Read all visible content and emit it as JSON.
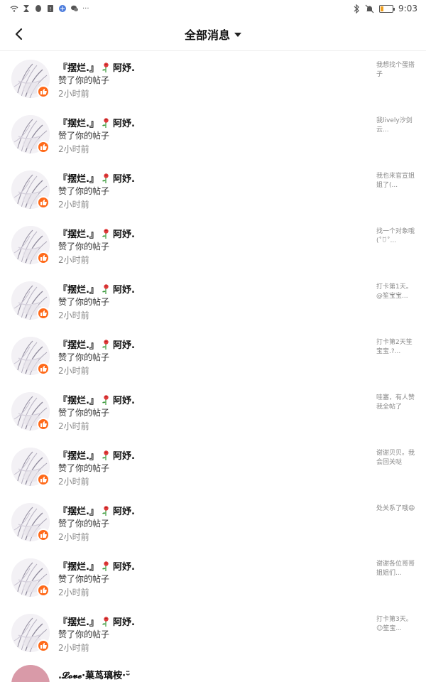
{
  "status_bar": {
    "time": "9:03",
    "left_icons": [
      "wifi-icon",
      "hourglass-icon",
      "qq-icon",
      "sim-icon",
      "browser-icon",
      "wechat-icon",
      "more-dots-icon"
    ],
    "more_label": "···",
    "right_icons": [
      "bluetooth-icon",
      "mute-icon",
      "battery-icon"
    ],
    "battery_level": 0.2
  },
  "header": {
    "title": "全部消息"
  },
  "notifications": [
    {
      "name_left": "『摆烂.』",
      "name_right": "阿妤.",
      "action": "赞了你的帖子",
      "time": "2小时前",
      "snippet": "我想找个蛋搭子"
    },
    {
      "name_left": "『摆烂.』",
      "name_right": "阿妤.",
      "action": "赞了你的帖子",
      "time": "2小时前",
      "snippet": "我lively汐剑云..."
    },
    {
      "name_left": "『摆烂.』",
      "name_right": "阿妤.",
      "action": "赞了你的帖子",
      "time": "2小时前",
      "snippet": "我也来官宣姐姐了(..."
    },
    {
      "name_left": "『摆烂.』",
      "name_right": "阿妤.",
      "action": "赞了你的帖子",
      "time": "2小时前",
      "snippet": "找一个对象哦(˚ꇴ˚..."
    },
    {
      "name_left": "『摆烂.』",
      "name_right": "阿妤.",
      "action": "赞了你的帖子",
      "time": "2小时前",
      "snippet": "打卡第1天。@笙宝宝..."
    },
    {
      "name_left": "『摆烂.』",
      "name_right": "阿妤.",
      "action": "赞了你的帖子",
      "time": "2小时前",
      "snippet": "打卡第2天笙宝宝.?..."
    },
    {
      "name_left": "『摆烂.』",
      "name_right": "阿妤.",
      "action": "赞了你的帖子",
      "time": "2小时前",
      "snippet": "哇塞，有人赞我全帖了"
    },
    {
      "name_left": "『摆烂.』",
      "name_right": "阿妤.",
      "action": "赞了你的帖子",
      "time": "2小时前",
      "snippet": "谢谢贝贝。我会回关哒"
    },
    {
      "name_left": "『摆烂.』",
      "name_right": "阿妤.",
      "action": "赞了你的帖子",
      "time": "2小时前",
      "snippet": "处关系了哦😄"
    },
    {
      "name_left": "『摆烂.』",
      "name_right": "阿妤.",
      "action": "赞了你的帖子",
      "time": "2小时前",
      "snippet": "谢谢各位哥哥姐姐们..."
    },
    {
      "name_left": "『摆烂.』",
      "name_right": "阿妤.",
      "action": "赞了你的帖子",
      "time": "2小时前",
      "snippet": "打卡第3天。😉笙宝..."
    }
  ],
  "partial_item": {
    "name": ".𝓛𝓸𝓿𝓮·菓茑璃桉·ᵕ̈"
  },
  "colors": {
    "badge": "#ff6a1a",
    "secondary_text": "#888888",
    "snippet_text": "#8a8a8a"
  }
}
